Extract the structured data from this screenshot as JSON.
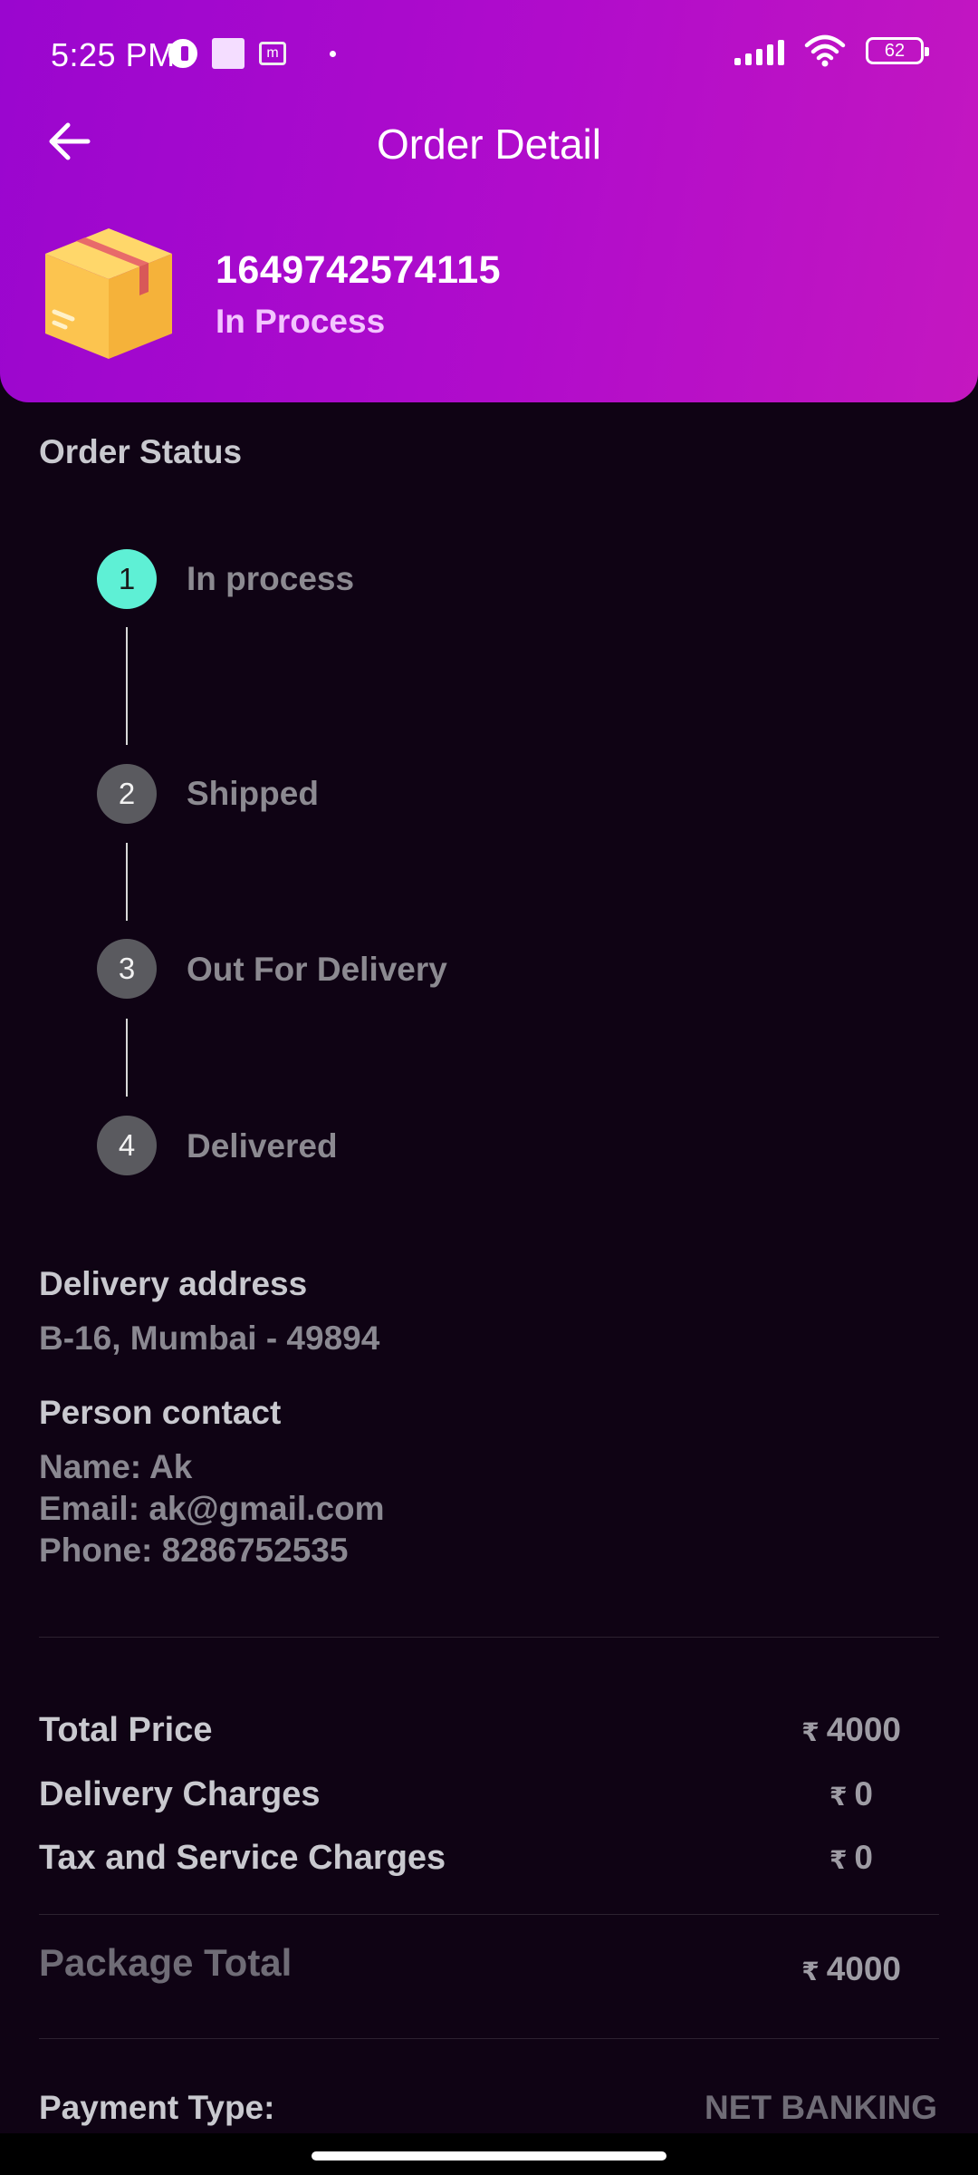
{
  "status_bar": {
    "time": "5:25 PM",
    "m_label": "m",
    "battery": "62"
  },
  "header": {
    "title": "Order Detail",
    "order_id": "1649742574115",
    "order_status": "In Process"
  },
  "order_status": {
    "title": "Order Status",
    "steps": [
      {
        "number": "1",
        "label": "In process",
        "active": true
      },
      {
        "number": "2",
        "label": "Shipped",
        "active": false
      },
      {
        "number": "3",
        "label": "Out For Delivery",
        "active": false
      },
      {
        "number": "4",
        "label": "Delivered",
        "active": false
      }
    ]
  },
  "delivery": {
    "title": "Delivery address",
    "address": "B-16, Mumbai - 49894"
  },
  "contact": {
    "title": "Person contact",
    "name": "Name: Ak",
    "email": "Email: ak@gmail.com",
    "phone": "Phone: 8286752535"
  },
  "pricing": {
    "currency": "₹",
    "total_price_label": "Total Price",
    "total_price_value": "4000",
    "delivery_label": "Delivery Charges",
    "delivery_value": "0",
    "tax_label": "Tax and Service Charges",
    "tax_value": "0",
    "package_total_label": "Package Total",
    "package_total_value": "4000"
  },
  "payment": {
    "label": "Payment Type:",
    "value": "NET BANKING"
  },
  "colors": {
    "header_gradient_start": "#9a06cf",
    "header_gradient_end": "#c417c0",
    "active_step": "#5ef0d5",
    "background": "#0f0314"
  }
}
